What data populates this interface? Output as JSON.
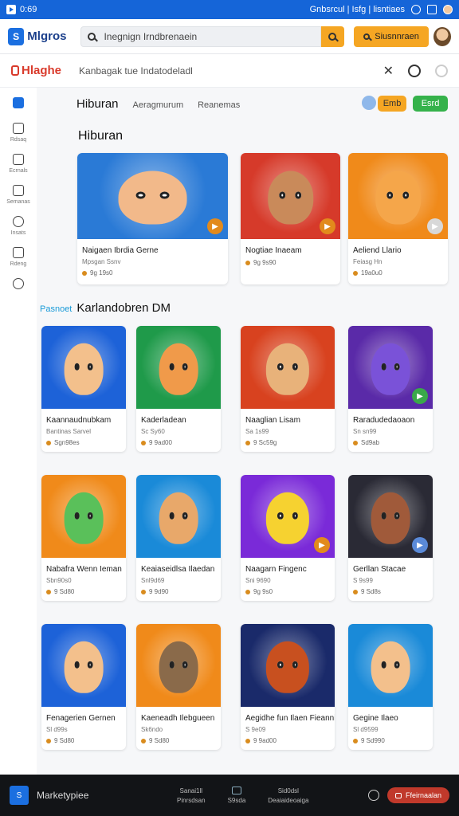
{
  "status": {
    "time": "0:69",
    "right_text": "Gnbsrcul | Isfg | lisntiaes"
  },
  "topbar": {
    "logo": "S",
    "brand": "Mlgros",
    "search_placeholder": "Inegnign Irndbrenaein",
    "cta_label": "Siusnnraen"
  },
  "subbar": {
    "logo_text": "Hlaghe",
    "breadcrumb": "Kanbagak  tue Indatodeladl"
  },
  "sidebar": {
    "items": [
      {
        "label": "",
        "icon": "home-icon"
      },
      {
        "label": "Rdsaq",
        "icon": "grid-icon"
      },
      {
        "label": "Ecrnals",
        "icon": "chat-icon"
      },
      {
        "label": "Semanas",
        "icon": "window-icon"
      },
      {
        "label": "Insats",
        "icon": "compass-icon"
      },
      {
        "label": "Rdeng",
        "icon": "image-icon"
      },
      {
        "label": "",
        "icon": "cloud-icon"
      }
    ]
  },
  "tabs": [
    {
      "label": "Hiburan",
      "active": true
    },
    {
      "label": "Aeragmurum",
      "active": false
    },
    {
      "label": "Reanemas",
      "active": false
    }
  ],
  "actions": {
    "btn1": "Emb",
    "btn2": "Esrd"
  },
  "section1": {
    "title": "Hiburan",
    "cards": [
      {
        "title": "Naigaen Ibrdia Gerne",
        "sub": "Mpsgan Ssnv",
        "meta": "9g 19s0",
        "bg": "#2a7ad6",
        "face": "#f2b98a",
        "badge": "#e28a1c"
      },
      {
        "title": "Nogtiae Inaeam",
        "sub": "",
        "meta": "9g 9s90",
        "bg": "#d63a2a",
        "face": "#c98a5a",
        "badge": "#e28a1c"
      },
      {
        "title": "Aeliend Llario",
        "sub": "Feiasg Hn",
        "meta": "19a0u0",
        "bg": "#f08a1a",
        "face": "#f5a64a",
        "badge": "#d8d8d8"
      }
    ]
  },
  "section2": {
    "accent": "Pasnoet",
    "title": "Karlandobren DM",
    "cards": [
      {
        "title": "Kaannaudnubkam",
        "sub": "Bantinas Sarvel",
        "meta": "Sgn98es",
        "bg": "#1d62d8",
        "face": "#f3c08c",
        "badge": ""
      },
      {
        "title": "Kaderladean",
        "sub": "Sc Sy60",
        "meta": "9 9ad00",
        "bg": "#1f9a4a",
        "face": "#f09a4a",
        "badge": ""
      },
      {
        "title": "Naaglian Lisam",
        "sub": "Sa 1s99",
        "meta": "9 Sc59g",
        "bg": "#d8421f",
        "face": "#e8b27a",
        "badge": ""
      },
      {
        "title": "Raradudedaoaon",
        "sub": "Sn sn99",
        "meta": "Sd9ab",
        "bg": "#5a2aa8",
        "face": "#7a52d8",
        "badge": "#3aa84a"
      },
      {
        "title": "Nabafra Wenn Ieman",
        "sub": "Sbn90s0",
        "meta": "9 Sd80",
        "bg": "#f08a1a",
        "face": "#5ac05a",
        "badge": ""
      },
      {
        "title": "Keaiaseidlsa Ilaedan",
        "sub": "Snl9d69",
        "meta": "9 9d90",
        "bg": "#1a8ad8",
        "face": "#e8a86a",
        "badge": ""
      },
      {
        "title": "Naagarn Fingenc",
        "sub": "Sni 9690",
        "meta": "9g 9s0",
        "bg": "#7a2ad8",
        "face": "#f6d230",
        "badge": "#e28a1c"
      },
      {
        "title": "Gerllan Stacae",
        "sub": "S 9s99",
        "meta": "9 Sd8s",
        "bg": "#2a2a35",
        "face": "#a05a3a",
        "badge": "#5a8ad8"
      },
      {
        "title": "Fenagerien Gernen",
        "sub": "Sl d99s",
        "meta": "9 Sd80",
        "bg": "#1d62d8",
        "face": "#f3c08c",
        "badge": ""
      },
      {
        "title": "Kaeneadh Ilebgueen",
        "sub": "Sk6ndo",
        "meta": "9 Sd80",
        "bg": "#f08a1a",
        "face": "#8a6a4a",
        "badge": ""
      },
      {
        "title": "Aegidhe fun Ilaen Fieanni",
        "sub": "S 9e09",
        "meta": "9 9ad00",
        "bg": "#1a2a6a",
        "face": "#c8501f",
        "badge": ""
      },
      {
        "title": "Gegine Ilaeo",
        "sub": "Sl d9599",
        "meta": "9 Sd990",
        "bg": "#1a8ad8",
        "face": "#f3c08c",
        "badge": ""
      }
    ]
  },
  "bottombar": {
    "logo": "S",
    "brand": "Marketypiee",
    "mid1": "Sanai1ll",
    "mid1_sub": "Pinrsdsan",
    "mid2_sub": "S9sda",
    "mid3": "Sid0dsl",
    "mid3_sub": "Deaiaideoaiga",
    "btn": "Ffeirnaalan"
  }
}
